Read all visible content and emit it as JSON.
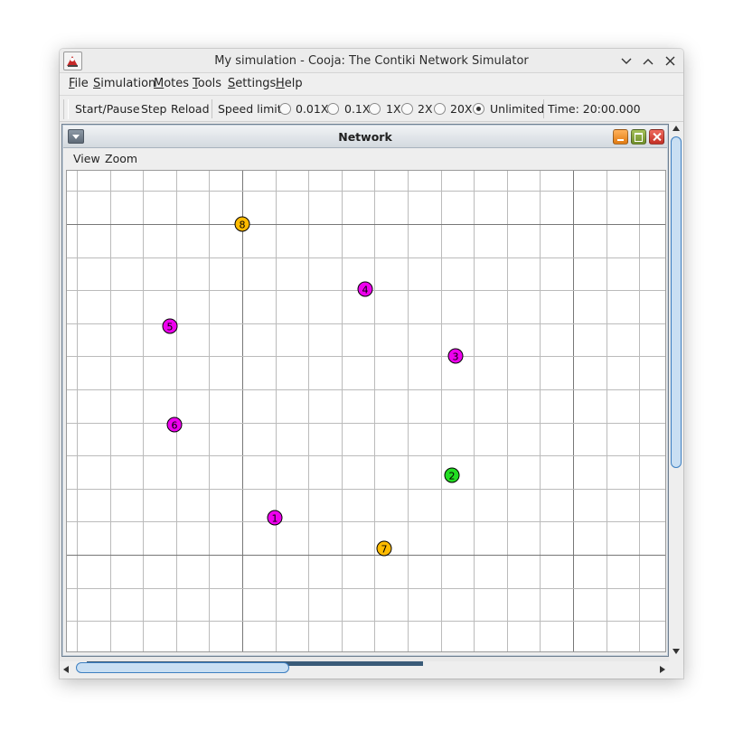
{
  "window": {
    "title": "My simulation - Cooja: The Contiki Network Simulator",
    "app_icon": "cooja-app-icon",
    "controls": [
      "minimize-icon",
      "maximize-icon",
      "close-icon"
    ]
  },
  "menubar": {
    "items": [
      "File",
      "Simulation",
      "Motes",
      "Tools",
      "Settings",
      "Help"
    ]
  },
  "toolbar": {
    "start_pause": "Start/Pause",
    "step": "Step",
    "reload": "Reload",
    "speed_limit_label": "Speed limit:",
    "speed_options": [
      {
        "label": "0.01X",
        "selected": false
      },
      {
        "label": "0.1X",
        "selected": false
      },
      {
        "label": "1X",
        "selected": false
      },
      {
        "label": "2X",
        "selected": false
      },
      {
        "label": "20X",
        "selected": false
      },
      {
        "label": "Unlimited",
        "selected": true
      }
    ],
    "time": "Time: 20:00.000"
  },
  "network_frame": {
    "title": "Network",
    "menu": [
      "View",
      "Zoom"
    ]
  },
  "motes": [
    {
      "id": "1",
      "color": "#ee00ee"
    },
    {
      "id": "2",
      "color": "#22dd22"
    },
    {
      "id": "3",
      "color": "#ee00ee"
    },
    {
      "id": "4",
      "color": "#ee00ee"
    },
    {
      "id": "5",
      "color": "#ee00ee"
    },
    {
      "id": "6",
      "color": "#ee00ee"
    },
    {
      "id": "7",
      "color": "#ffbb00"
    },
    {
      "id": "8",
      "color": "#ffbb00"
    }
  ],
  "colors": {
    "grid_minor": "#bbbbbb",
    "grid_major": "#777777",
    "scroll_thumb": "#c9dff3"
  }
}
